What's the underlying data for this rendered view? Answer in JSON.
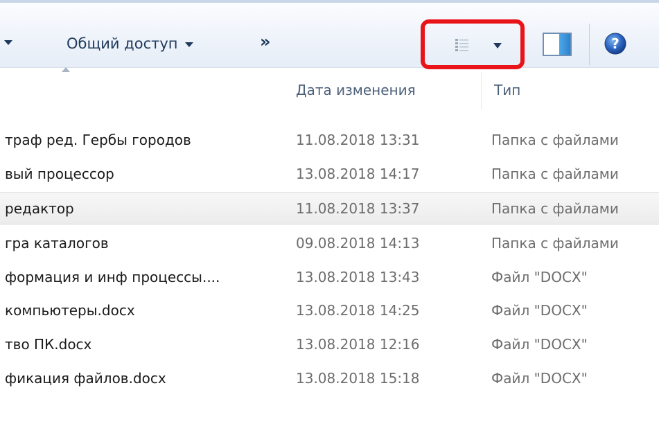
{
  "toolbar": {
    "share_label": "Общий доступ",
    "more_label": "»",
    "views_icon": "details-view-icon",
    "preview_icon": "preview-pane-icon",
    "help_icon": "help-icon",
    "highlight_color": "#e8141a"
  },
  "columns": {
    "date": "Дата изменения",
    "type": "Тип"
  },
  "rows": [
    {
      "name": "траф ред. Гербы городов",
      "date": "11.08.2018 13:31",
      "type": "Папка с файлами"
    },
    {
      "name": "вый процессор",
      "date": "13.08.2018 14:17",
      "type": "Папка с файлами"
    },
    {
      "name": "редактор",
      "date": "11.08.2018 13:37",
      "type": "Папка с файлами",
      "selected": true
    },
    {
      "name": "гра каталогов",
      "date": "09.08.2018 14:13",
      "type": "Папка с файлами"
    },
    {
      "name": "формация и инф процессы....",
      "date": "13.08.2018 13:43",
      "type": "Файл \"DOCX\""
    },
    {
      "name": "компьютеры.docx",
      "date": "13.08.2018 14:25",
      "type": "Файл \"DOCX\""
    },
    {
      "name": "тво ПК.docx",
      "date": "13.08.2018 12:16",
      "type": "Файл \"DOCX\""
    },
    {
      "name": "фикация файлов.docx",
      "date": "13.08.2018 15:18",
      "type": "Файл \"DOCX\""
    }
  ]
}
